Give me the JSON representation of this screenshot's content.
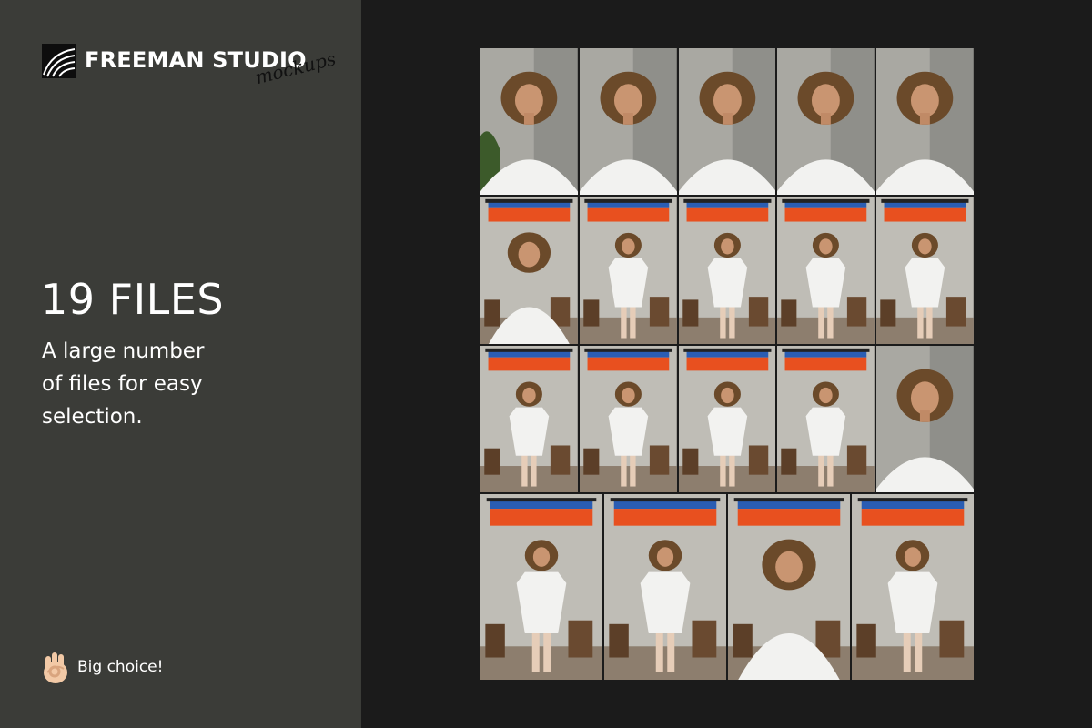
{
  "brand": {
    "name": "FREEMAN STUDIO",
    "subtitle": "mockups"
  },
  "headline": "19 FILES",
  "description": {
    "lines": [
      "A large number",
      "of files for easy",
      "selection."
    ]
  },
  "footer": {
    "icon": "ok-hand-icon",
    "label": "Big choice!"
  },
  "colors": {
    "left_panel_bg": "#3b3c38",
    "right_panel_bg": "#1b1b1b",
    "backdrop_orange": "#e8501f",
    "backdrop_blue": "#2a5db3",
    "shirt_white": "#f2f2f0"
  },
  "gallery": {
    "photo_count": 19,
    "rows": [
      {
        "count": 5,
        "scene": "closeup"
      },
      {
        "count": 5,
        "scene": "full_body"
      },
      {
        "count": 5,
        "scene": "mixed"
      },
      {
        "count": 4,
        "scene": "full_body"
      }
    ]
  }
}
